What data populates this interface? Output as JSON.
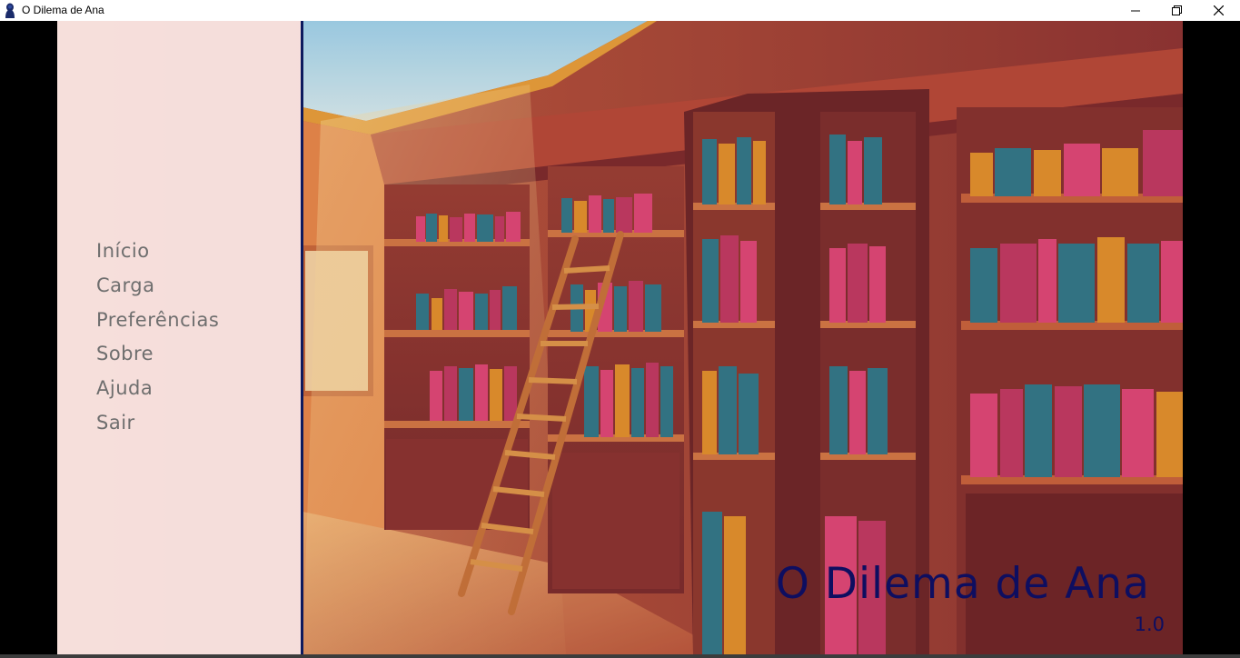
{
  "window": {
    "title": "O Dilema de Ana",
    "controls": [
      "minimize-icon",
      "maximize-icon",
      "close-icon"
    ]
  },
  "main_menu": {
    "items": [
      {
        "label": "Início"
      },
      {
        "label": "Carga"
      },
      {
        "label": "Preferências"
      },
      {
        "label": "Sobre"
      },
      {
        "label": "Ajuda"
      },
      {
        "label": "Sair"
      }
    ]
  },
  "game": {
    "title": "O Dilema de Ana",
    "version": "1.0"
  },
  "colors": {
    "menu_text": "#6e6e6e",
    "title_text": "#0e0e60",
    "divider": "#0d1a5e",
    "menu_panel": "#fff4f6"
  },
  "background": {
    "scene": "library-with-bookshelves-and-ladder"
  }
}
